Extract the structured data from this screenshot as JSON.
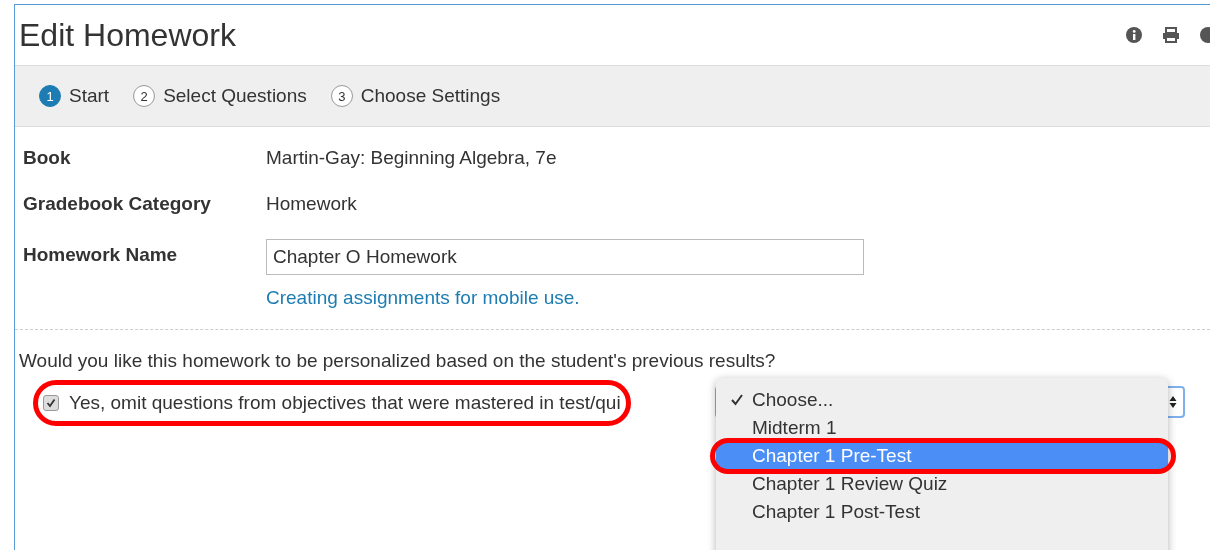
{
  "title": "Edit Homework",
  "steps": [
    {
      "number": "1",
      "label": "Start",
      "selected": true
    },
    {
      "number": "2",
      "label": "Select Questions",
      "selected": false
    },
    {
      "number": "3",
      "label": "Choose Settings",
      "selected": false
    }
  ],
  "fields": [
    {
      "kind": "text",
      "label": "Book",
      "value": "Martin-Gay: Beginning Algebra, 7e"
    },
    {
      "kind": "text",
      "label": "Gradebook Category",
      "value": "Homework"
    },
    {
      "kind": "input",
      "label": "Homework Name",
      "value": "Chapter O Homework",
      "link": "Creating assignments for mobile use."
    }
  ],
  "question": "Would you like this homework to be personalized based on the student's previous results?",
  "option": {
    "label": "Yes, omit questions from objectives that were mastered in test/qui",
    "checked": true,
    "annotated": true
  },
  "menu": [
    {
      "label": "Choose...",
      "checked": true,
      "selected": false,
      "annotated": false
    },
    {
      "label": "Midterm 1",
      "checked": false,
      "selected": false,
      "annotated": false
    },
    {
      "label": "Chapter 1 Pre-Test",
      "checked": false,
      "selected": true,
      "annotated": true
    },
    {
      "label": "Chapter 1 Review Quiz",
      "checked": false,
      "selected": false,
      "annotated": false
    },
    {
      "label": "Chapter 1 Post-Test",
      "checked": false,
      "selected": false,
      "annotated": false
    }
  ]
}
